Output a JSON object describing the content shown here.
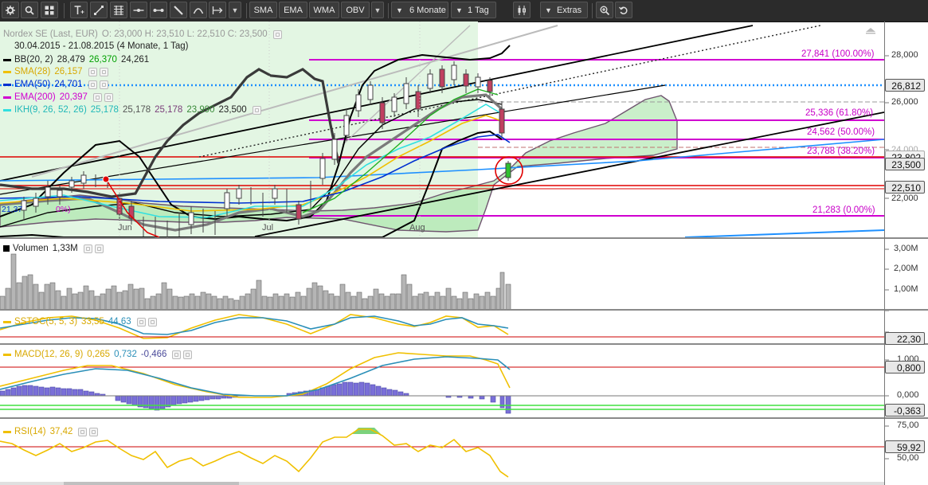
{
  "toolbar": {
    "indicators": [
      "SMA",
      "EMA",
      "WMA",
      "OBV"
    ],
    "period": "6 Monate",
    "interval": "1 Tag",
    "extras": "Extras"
  },
  "main_pane": {
    "legend": {
      "title": "Nordex SE (Last, EUR)",
      "ohlc": "O: 23,000   H: 23,510   L: 22,510   C: 23,500",
      "range": "30.04.2015 - 21.08.2015 (4 Monate, 1 Tag)",
      "bb": {
        "name": "BB(20, 2)",
        "v1": "28,479",
        "v2": "26,370",
        "v3": "24,261"
      },
      "sma": {
        "name": "SMA(28)",
        "v1": "26,157"
      },
      "ema50": {
        "name": "EMA(50)",
        "v1": "24,701"
      },
      "ema200": {
        "name": "EMA(200)",
        "v1": "20,397"
      },
      "ikh": {
        "name": "IKH(9, 26, 52, 26)",
        "v1": "25,178",
        "v2": "25,178",
        "v3": "25,178",
        "v4": "23,990",
        "v5": "23,500"
      }
    },
    "axis_labels": [
      "28,000",
      "26,000",
      "24,000",
      "22,000"
    ],
    "price_boxes": {
      "a": "26,812",
      "b": "23,802",
      "c": "23,500",
      "d": "22,510"
    },
    "fib_labels": [
      "27,841 (100.00%)",
      "25,336 (61.80%)",
      "24,562 (50.00%)",
      "23,788 (38.20%)",
      "21,283 (0.00%)"
    ],
    "left_partial": "21,37",
    "left_partial2": "0%)",
    "months": [
      "Jun",
      "Jul",
      "Aug"
    ]
  },
  "volume_pane": {
    "title": "Volumen",
    "value": "1,33M",
    "axis": [
      "3,00M",
      "2,00M",
      "1,00M"
    ]
  },
  "sstoc_pane": {
    "title": "SSTOC(5, 5, 3)",
    "v1": "33,55",
    "v2": "44,63",
    "box": "22,30"
  },
  "macd_pane": {
    "title": "MACD(12, 26, 9)",
    "v1": "0,265",
    "v2": "0,732",
    "v3": "-0,466",
    "axis": [
      "1,000",
      "0,000"
    ],
    "box_a": "0,800",
    "box_b": "-0,363"
  },
  "rsi_pane": {
    "title": "RSI(14)",
    "v1": "37,42",
    "axis": [
      "75,00",
      "50,00"
    ],
    "box": "59,92"
  },
  "colors": {
    "bb": "#000000",
    "sma": "#f0c000",
    "ema50": "#0030d0",
    "ema200": "#d000d0",
    "ikh": "#30e0e0",
    "fib": "#d000d0",
    "support": "#e00000",
    "volume": "#a0a0a0",
    "macd_hist": "#7a6fd8",
    "cloud": "#a8e8a8"
  }
}
